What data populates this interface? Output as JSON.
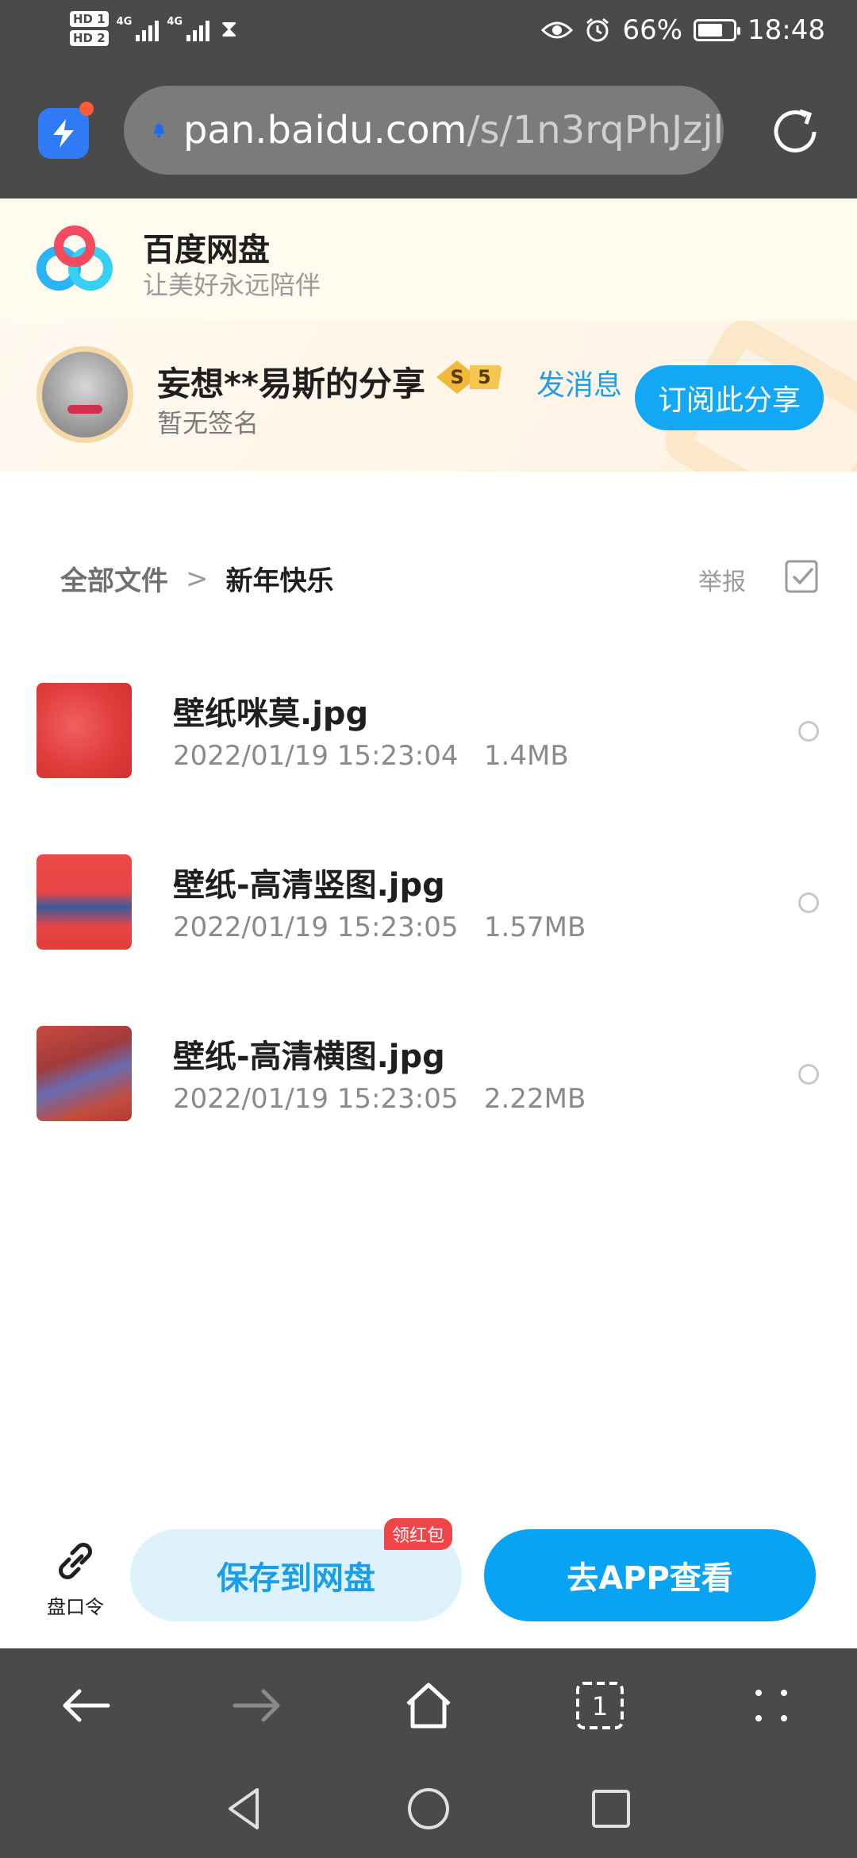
{
  "status_bar": {
    "hd1": "HD 1",
    "hd2": "HD 2",
    "network1": "4G",
    "network2": "4G",
    "battery_percent": "66%",
    "time": "18:48"
  },
  "browser": {
    "url_host": "pan.baidu.com",
    "url_path": "/s/1n3rqPhJzjl"
  },
  "brand": {
    "name": "百度网盘",
    "slogan": "让美好永远陪伴"
  },
  "sharer": {
    "name": "妄想**易斯的分享",
    "level_letter": "S",
    "level_number": "5",
    "send_message": "发消息",
    "signature": "暂无签名",
    "subscribe": "订阅此分享"
  },
  "breadcrumb": {
    "all_files": "全部文件",
    "separator": ">",
    "current": "新年快乐",
    "report": "举报"
  },
  "files": [
    {
      "name": "壁纸咪莫.jpg",
      "date": "2022/01/19 15:23:04",
      "size": "1.4MB"
    },
    {
      "name": "壁纸-高清竖图.jpg",
      "date": "2022/01/19 15:23:05",
      "size": "1.57MB"
    },
    {
      "name": "壁纸-高清横图.jpg",
      "date": "2022/01/19 15:23:05",
      "size": "2.22MB"
    }
  ],
  "actions": {
    "pan_code": "盘口令",
    "save": "保存到网盘",
    "red_packet": "领红包",
    "open_app": "去APP查看"
  },
  "browser_nav": {
    "tab_count": "1"
  },
  "colors": {
    "primary_blue": "#09a3f4",
    "link_blue": "#1e9ee8",
    "dark_bar": "#4a4a4a",
    "red_badge": "#f2454a"
  }
}
